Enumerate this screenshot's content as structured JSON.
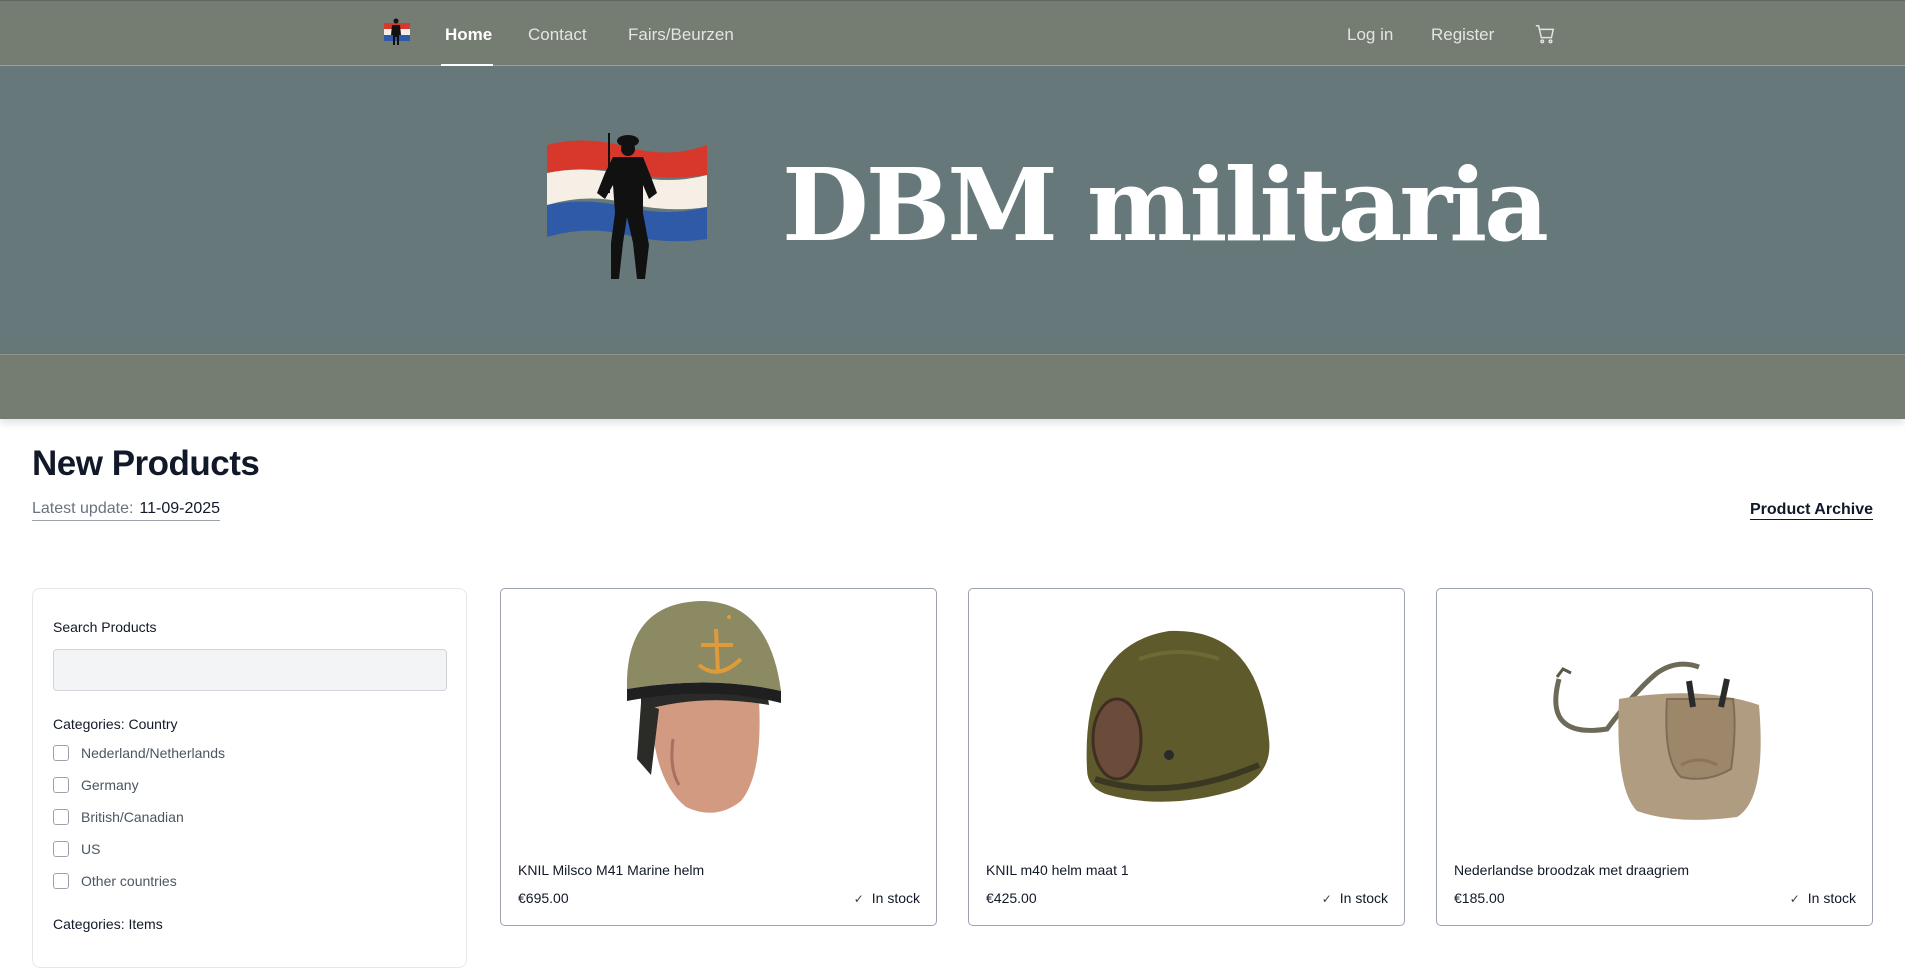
{
  "nav": {
    "logo_icon": "flag-soldier-logo-icon",
    "links": [
      "Home",
      "Contact",
      "Fairs/Beurzen"
    ],
    "login": "Log in",
    "register": "Register",
    "cart_icon": "shopping-cart-icon"
  },
  "hero": {
    "title": "DBM militaria",
    "logo_icon": "flag-soldier-logo-icon"
  },
  "products_section": {
    "title": "New Products",
    "latest_update_label": "Latest update:",
    "latest_update_value": "11-09-2025",
    "archive_link": "Product Archive"
  },
  "filters": {
    "search_label": "Search Products",
    "search_value": "",
    "country_heading": "Categories: Country",
    "countries": [
      "Nederland/Netherlands",
      "Germany",
      "British/Canadian",
      "US",
      "Other countries"
    ],
    "items_heading": "Categories: Items"
  },
  "products": [
    {
      "name": "KNIL Milsco M41 Marine helm",
      "price": "€695.00",
      "stock": "In stock",
      "image_icon": "helmet-on-mannequin-image"
    },
    {
      "name": "KNIL m40 helm maat 1",
      "price": "€425.00",
      "stock": "In stock",
      "image_icon": "helmet-image"
    },
    {
      "name": "Nederlandse broodzak met draagriem",
      "price": "€185.00",
      "stock": "In stock",
      "image_icon": "bread-bag-image"
    }
  ],
  "colors": {
    "nav_bg": "#757d72",
    "hero_bg": "#667879",
    "flag_red": "#d8382b",
    "flag_white": "#f5efe6",
    "flag_blue": "#2f5aa8"
  }
}
